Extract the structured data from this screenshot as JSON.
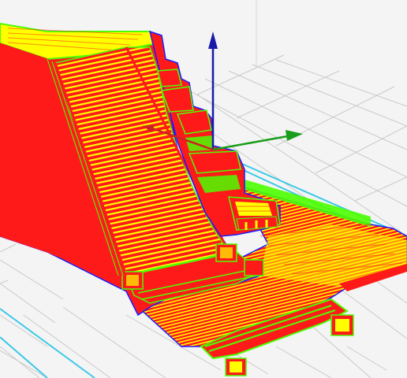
{
  "viewport": {
    "kind": "slicer-layer-preview",
    "background_color": "#f4f4f4",
    "grid_color": "#c9c9c9",
    "build_plate_outline_color": "#3cc8e6"
  },
  "model": {
    "layer_colors": {
      "shell": "#ff1a1a",
      "infill": "#ffff00",
      "skin_edge": "#4cff00",
      "outline": "#1a1aff"
    }
  },
  "gizmo": {
    "axes": [
      {
        "name": "y-axis",
        "color": "#1a1aa8"
      },
      {
        "name": "x-axis",
        "color": "#1a9e1a"
      },
      {
        "name": "z-axis",
        "color": "#cc2222"
      }
    ]
  }
}
